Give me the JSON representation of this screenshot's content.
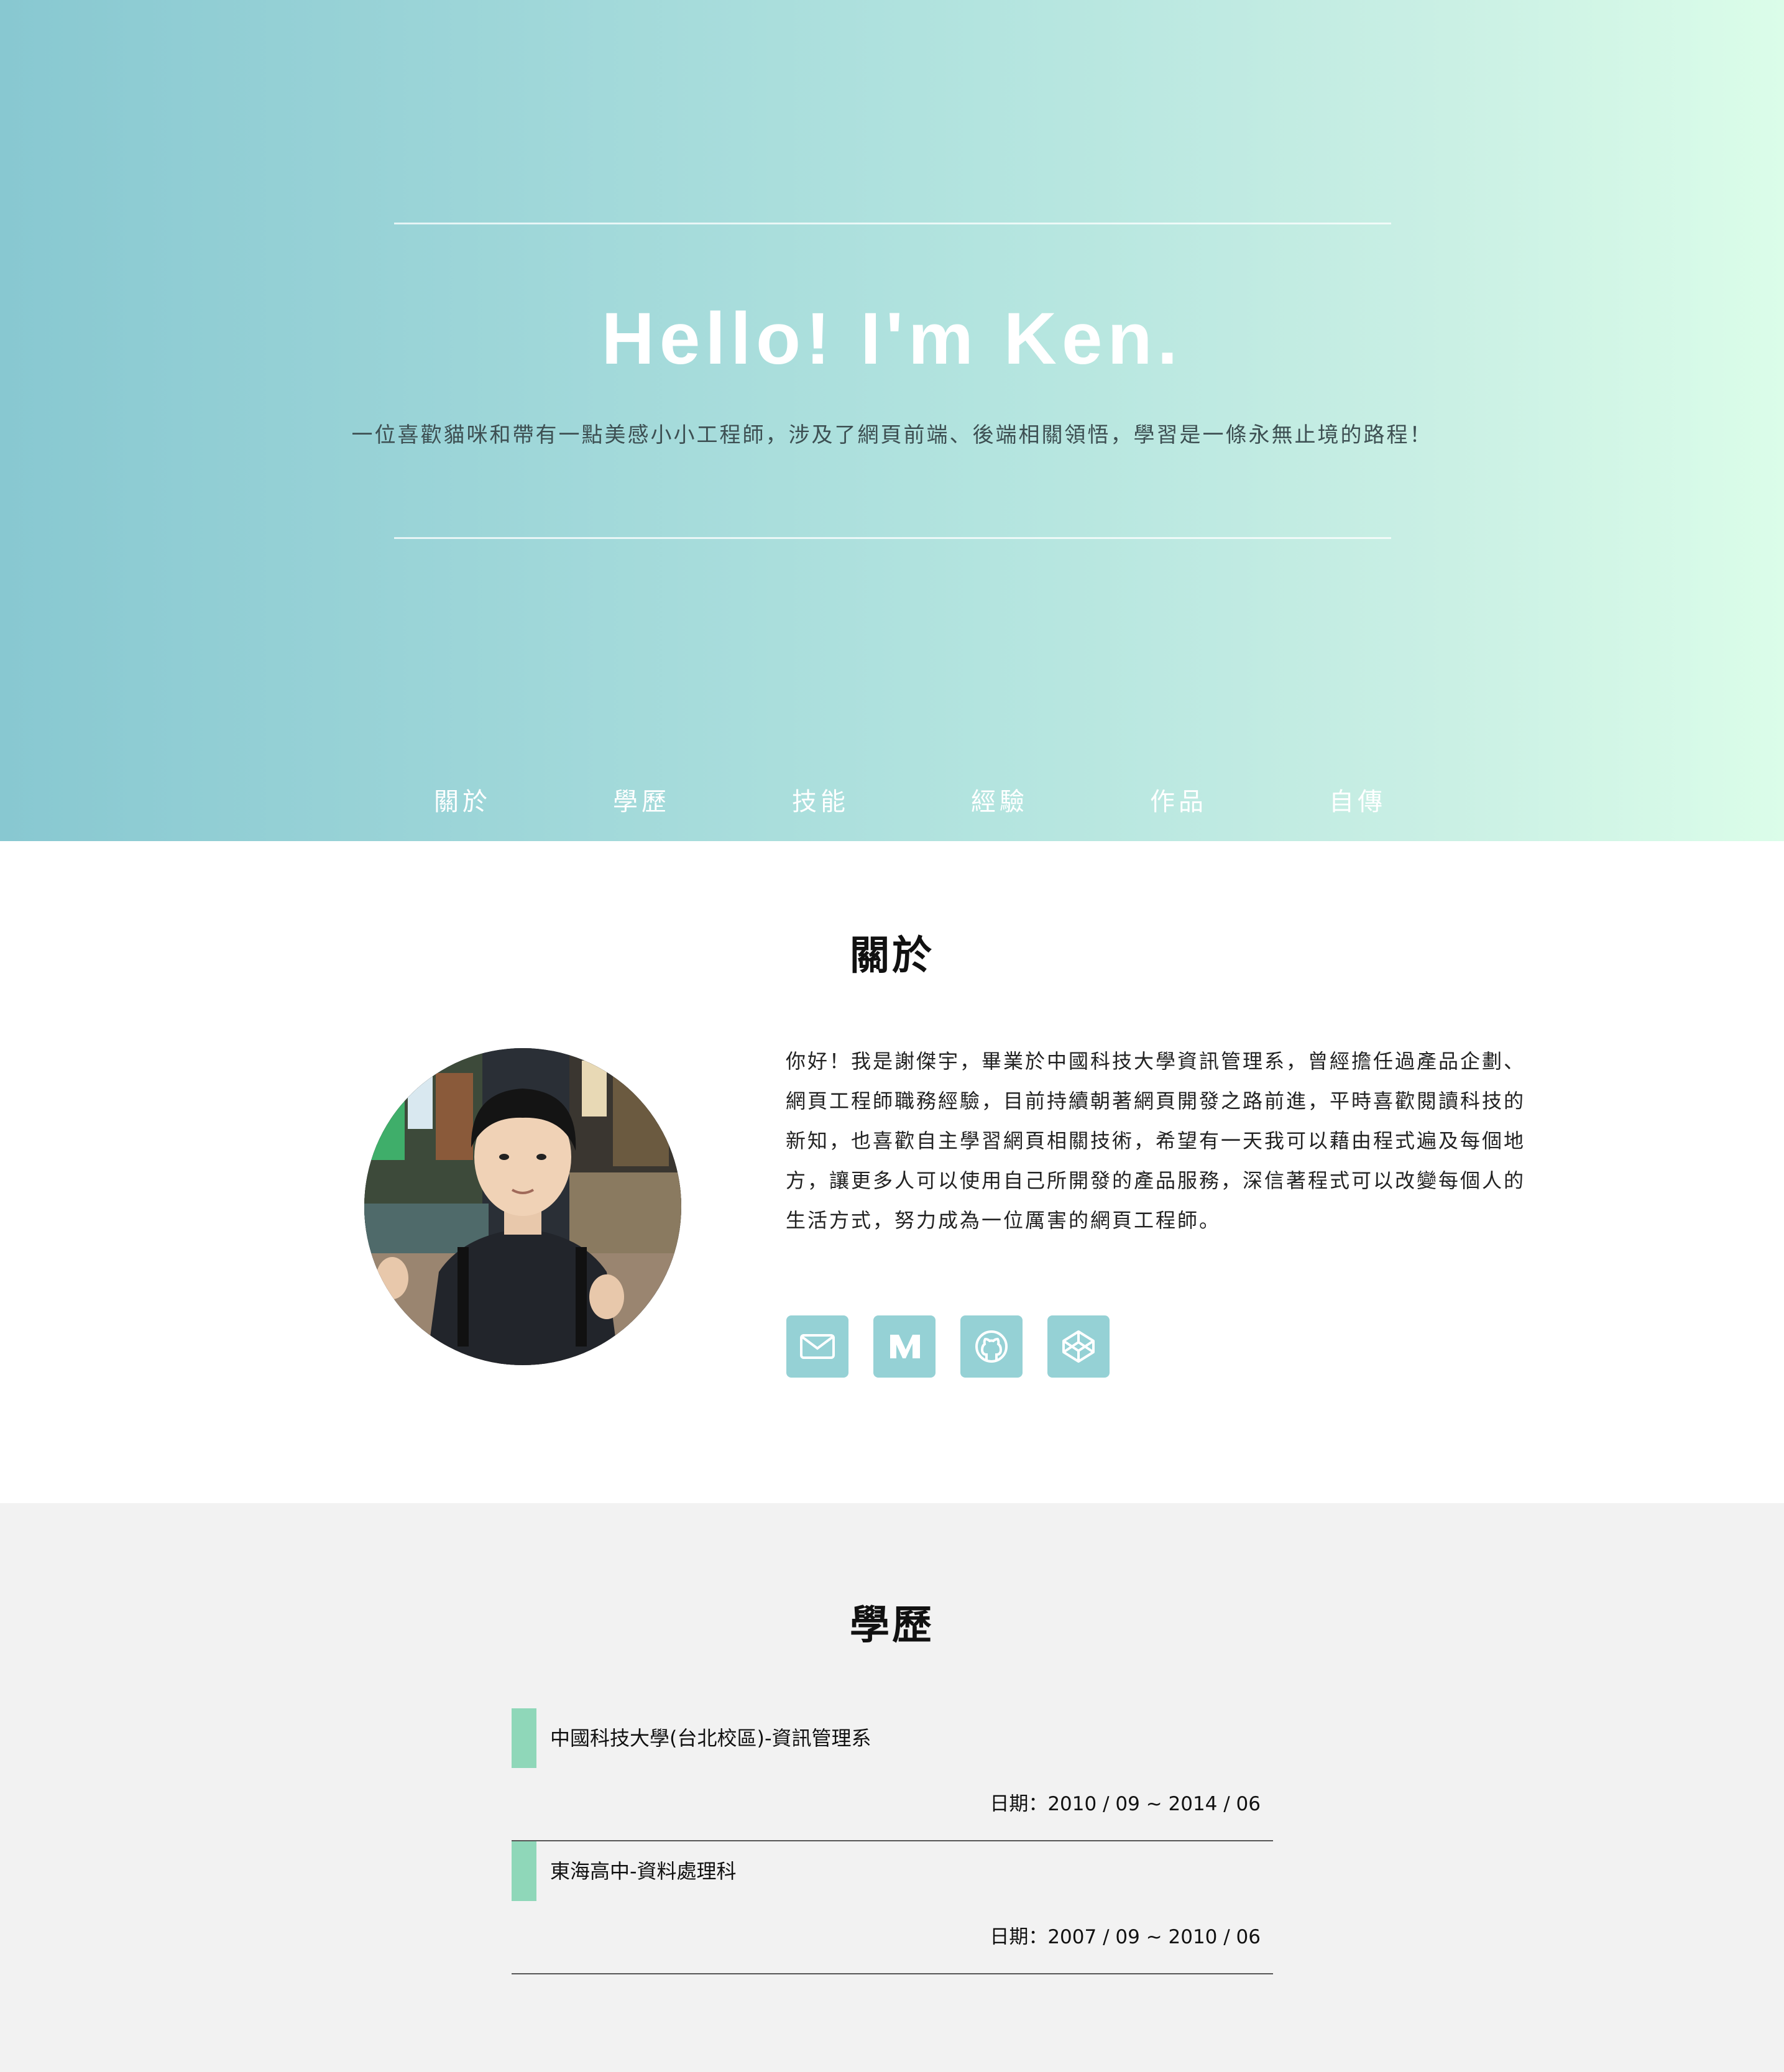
{
  "hero": {
    "title": "Hello! I'm Ken.",
    "subtitle": "一位喜歡貓咪和帶有一點美感小小工程師，涉及了網頁前端、後端相關領悟，學習是一條永無止境的路程！",
    "nav": [
      {
        "label": "關於"
      },
      {
        "label": "學歷"
      },
      {
        "label": "技能"
      },
      {
        "label": "經驗"
      },
      {
        "label": "作品"
      },
      {
        "label": "自傳"
      }
    ],
    "gradient_colors": [
      "#88c8d1",
      "#dbfde9"
    ]
  },
  "about": {
    "title": "關於",
    "paragraph": "你好！我是謝傑宇，畢業於中國科技大學資訊管理系，曾經擔任過產品企劃、網頁工程師職務經驗，目前持續朝著網頁開發之路前進，平時喜歡閱讀科技的新知，也喜歡自主學習網頁相關技術，希望有一天我可以藉由程式遍及每個地方，讓更多人可以使用自己所開發的產品服務，深信著程式可以改變每個人的生活方式，努力成為一位厲害的網頁工程師。",
    "social": [
      {
        "icon": "mail-icon"
      },
      {
        "icon": "medium-icon"
      },
      {
        "icon": "github-icon"
      },
      {
        "icon": "codepen-icon"
      }
    ],
    "accent_color": "#95d1d5"
  },
  "education": {
    "title": "學歷",
    "items": [
      {
        "name": "中國科技大學(台北校區)-資訊管理系",
        "date": "日期：2010 / 09 ~ 2014 / 06"
      },
      {
        "name": "東海高中-資料處理科",
        "date": "日期：2007 / 09 ~ 2010 / 06"
      }
    ],
    "bar_color": "#8fd7b9"
  }
}
